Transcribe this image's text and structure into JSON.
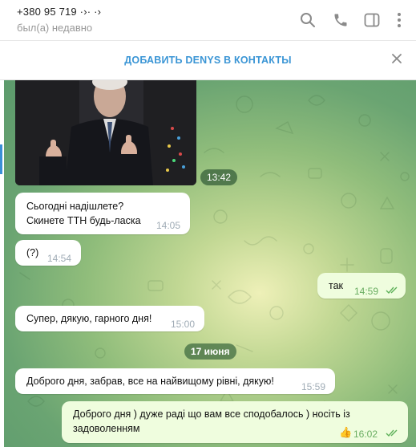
{
  "header": {
    "contact_title": "+380 95 719 ·›· ·›",
    "contact_status": "был(а) недавно",
    "icons": [
      "search-icon",
      "phone-icon",
      "sidebar-toggle-icon",
      "more-vertical-icon"
    ]
  },
  "banner": {
    "add_contact_label": "ДОБАВИТЬ DENYS В КОНТАКТЫ"
  },
  "colors": {
    "accent": "#3a95d5",
    "incoming_bubble": "#ffffff",
    "outgoing_bubble": "#effdde",
    "read_checks": "#5fb15a"
  },
  "messages": [
    {
      "type": "photo",
      "time": "13:42"
    },
    {
      "type": "in",
      "text": "Сьогодні надішлете?\nСкинете ТТН будь-ласка",
      "time": "14:05"
    },
    {
      "type": "in",
      "text": "(?)",
      "time": "14:54"
    },
    {
      "type": "out",
      "text": "так",
      "time": "14:59",
      "status": "read"
    },
    {
      "type": "in",
      "text": "Супер, дякую, гарного дня!",
      "time": "15:00"
    },
    {
      "type": "date",
      "label": "17 июня"
    },
    {
      "type": "in",
      "text": "Доброго дня, забрав, все на найвищому рівні, дякую!",
      "time": "15:59"
    },
    {
      "type": "out",
      "text": "Доброго дня ) дуже раді що вам все сподобалось ) носіть із задоволенням",
      "reaction": "👍",
      "time": "16:02",
      "status": "read"
    }
  ]
}
